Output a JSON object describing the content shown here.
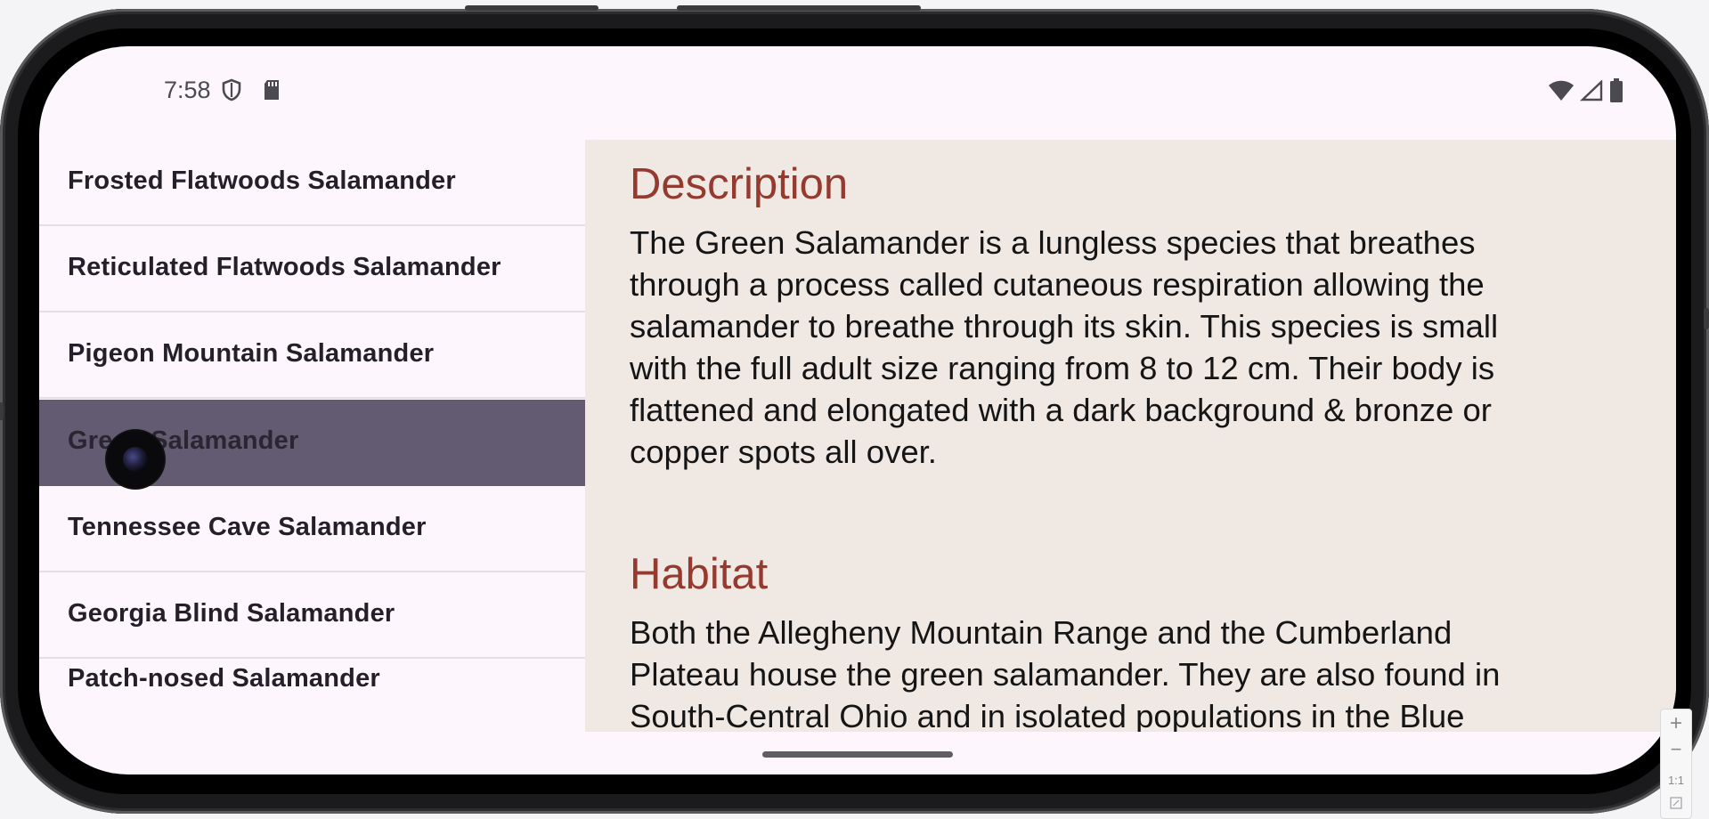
{
  "status_bar": {
    "time": "7:58",
    "left_icons": [
      "shield-icon",
      "sd-card-icon"
    ],
    "right_icons": [
      "wifi-icon",
      "signal-icon",
      "battery-icon"
    ]
  },
  "list": {
    "items": [
      {
        "label": "Frosted Flatwoods Salamander",
        "selected": false
      },
      {
        "label": "Reticulated Flatwoods Salamander",
        "selected": false
      },
      {
        "label": "Pigeon Mountain Salamander",
        "selected": false
      },
      {
        "label": "Green Salamander",
        "selected": true
      },
      {
        "label": "Tennessee Cave Salamander",
        "selected": false
      },
      {
        "label": "Georgia Blind Salamander",
        "selected": false
      },
      {
        "label": "Patch-nosed Salamander",
        "selected": false
      }
    ]
  },
  "detail": {
    "description_title": "Description",
    "description_lines": [
      "The Green Salamander is a lungless species that breathes",
      "through a process called cutaneous respiration allowing the",
      "salamander to breathe through its skin. This species is small",
      "with the full adult size ranging from 8 to 12 cm. Their body is",
      "flattened and elongated with a dark background & bronze or",
      "copper spots all over."
    ],
    "habitat_title": "Habitat",
    "habitat_lines": [
      "Both the Allegheny Mountain Range and the Cumberland",
      "Plateau house the green salamander. They are also found in",
      "South-Central Ohio and in isolated populations in the Blue"
    ]
  },
  "emulator_controls": {
    "zoom_in": "+",
    "zoom_out": "−",
    "reset": "1:1"
  },
  "colors": {
    "selected_row": "#625b71",
    "detail_background": "#f0e8e3",
    "heading": "#953a2e",
    "screen_background": "#fdf7fd"
  }
}
